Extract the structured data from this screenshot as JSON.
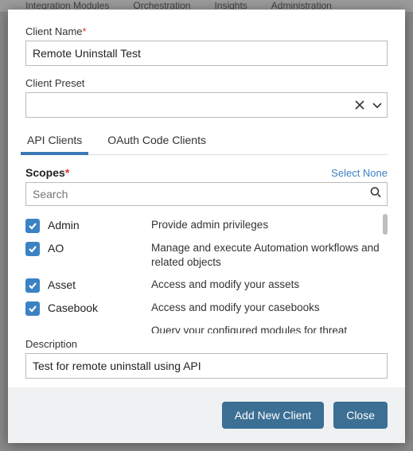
{
  "nav": {
    "items": [
      "Integration Modules",
      "Orchestration",
      "Insights",
      "Administration"
    ]
  },
  "form": {
    "client_name_label": "Client Name",
    "client_name_value": "Remote Uninstall Test",
    "client_preset_label": "Client Preset",
    "client_preset_value": ""
  },
  "tabs": {
    "api": "API Clients",
    "oauth": "OAuth Code Clients"
  },
  "scopes": {
    "title": "Scopes",
    "select_none": "Select None",
    "search_placeholder": "Search",
    "items": [
      {
        "name": "Admin",
        "desc": "Provide admin privileges",
        "checked": true
      },
      {
        "name": "AO",
        "desc": "Manage and execute Automation workflows and related objects",
        "checked": true
      },
      {
        "name": "Asset",
        "desc": "Access and modify your assets",
        "checked": true
      },
      {
        "name": "Casebook",
        "desc": "Access and modify your casebooks",
        "checked": true
      },
      {
        "name": "",
        "desc": "Query your configured modules for threat",
        "checked": true
      }
    ]
  },
  "description": {
    "label": "Description",
    "value": "Test for remote uninstall using API"
  },
  "footer": {
    "add": "Add New Client",
    "close": "Close"
  }
}
